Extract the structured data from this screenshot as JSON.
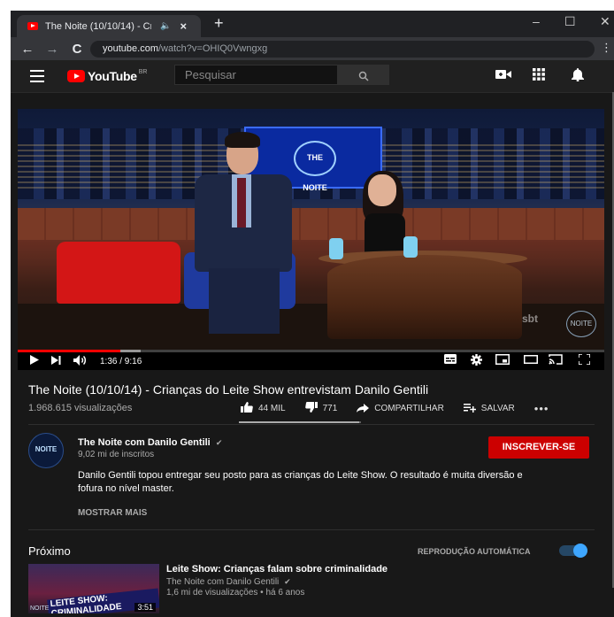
{
  "browser": {
    "tab_title": "The Noite (10/10/14) - Crian",
    "new_tab": "+",
    "close_tab": "×",
    "url_host": "youtube.com",
    "url_path": "/watch?v=OHIQ0Vwngxg",
    "minimize": "–",
    "maximize": "☐",
    "close": "✕",
    "back": "←",
    "forward": "→",
    "reload": "C",
    "menu": "⋮"
  },
  "youtube": {
    "logo_text": "YouTube",
    "region": "BR",
    "search_placeholder": "Pesquisar",
    "search_icon": "search-icon",
    "create_icon": "video-camera-icon",
    "apps_icon": "apps-grid-icon",
    "notifications_icon": "bell-icon"
  },
  "player": {
    "current_time": "1:36",
    "duration": "9:16",
    "time_display": "1:36 / 9:16",
    "progress": 0.1745,
    "buffered": 0.21,
    "screen_logo": "THE NOITE",
    "watermark_sbt": "sbt",
    "watermark_noite": "NOITE"
  },
  "video": {
    "title": "The Noite (10/10/14) - Crianças do Leite Show entrevistam Danilo Gentili",
    "views": "1.968.615 visualizações",
    "likes": "44 MIL",
    "dislikes": "771",
    "share": "COMPARTILHAR",
    "save": "SALVAR",
    "more": "•••",
    "like_ratio": 0.983
  },
  "channel": {
    "name": "The Noite com Danilo Gentili",
    "verified": "✔",
    "subscribers": "9,02 mi de inscritos",
    "subscribe_label": "INSCREVER-SE",
    "avatar_text": "NOITE",
    "description": "Danilo Gentili topou entregar seu posto para as crianças do Leite Show. O resultado é muita diversão e fofura no nível master.",
    "show_more": "MOSTRAR MAIS"
  },
  "up_next": {
    "label": "Próximo",
    "autoplay_label": "REPRODUÇÃO AUTOMÁTICA",
    "autoplay_on": true,
    "item": {
      "title": "Leite Show: Crianças falam sobre criminalidade",
      "channel": "The Noite com Danilo Gentili",
      "meta": "1,6 mi de visualizações • há 6 anos",
      "duration": "3:51",
      "thumb_text": "LEITE SHOW: CRIMINALIDADE",
      "thumb_logo": "NOITE"
    }
  },
  "colors": {
    "accent_red": "#ff0000",
    "subscribe_red": "#cc0000",
    "toggle_blue": "#3ea6ff"
  }
}
